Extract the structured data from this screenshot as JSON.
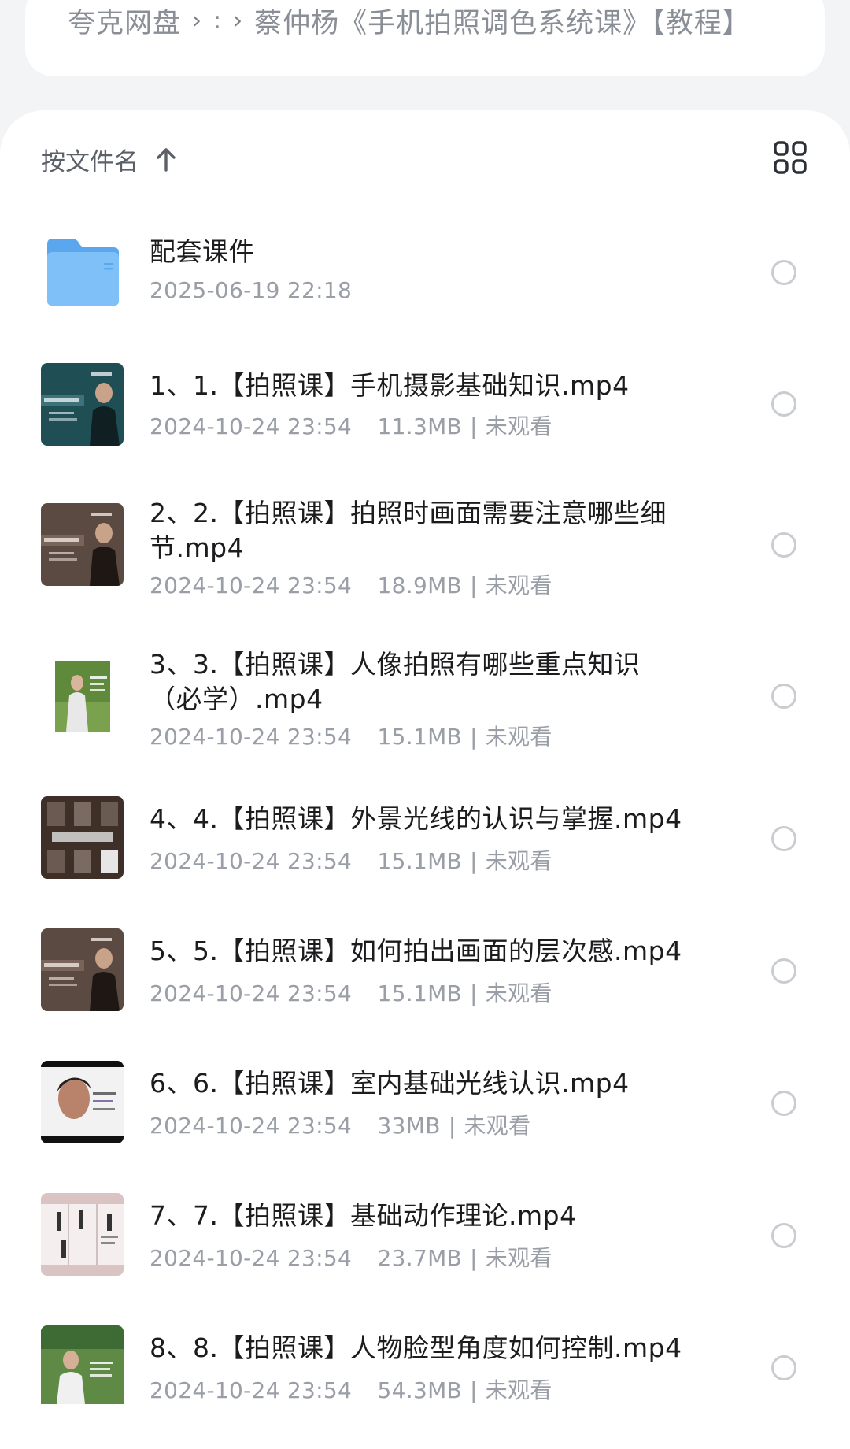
{
  "breadcrumb": {
    "root": "夸克网盘",
    "middle": ":",
    "current": "蔡仲杨《手机拍照调色系统课》【教程】"
  },
  "sort": {
    "label": "按文件名",
    "direction": "ascending"
  },
  "icons": {
    "sort": "arrow-up-icon",
    "view_toggle": "grid-view-icon",
    "folder": "folder-icon",
    "select": "radio-unchecked-icon"
  },
  "colors": {
    "folder": "#6db3f2",
    "background": "#f3f4f6",
    "meta_text": "#9a9ea6"
  },
  "files": [
    {
      "name": "配套课件",
      "type": "folder",
      "date": "2025-06-19 22:18",
      "size": "",
      "status": ""
    },
    {
      "name": "1、1.【拍照课】手机摄影基础知识.mp4",
      "type": "video",
      "date": "2024-10-24 23:54",
      "size": "11.3MB",
      "status": "未观看"
    },
    {
      "name": "2、2.【拍照课】拍照时画面需要注意哪些细节.mp4",
      "type": "video",
      "date": "2024-10-24 23:54",
      "size": "18.9MB",
      "status": "未观看"
    },
    {
      "name": "3、3.【拍照课】人像拍照有哪些重点知识（必学）.mp4",
      "type": "video",
      "date": "2024-10-24 23:54",
      "size": "15.1MB",
      "status": "未观看"
    },
    {
      "name": "4、4.【拍照课】外景光线的认识与掌握.mp4",
      "type": "video",
      "date": "2024-10-24 23:54",
      "size": "15.1MB",
      "status": "未观看"
    },
    {
      "name": "5、5.【拍照课】如何拍出画面的层次感.mp4",
      "type": "video",
      "date": "2024-10-24 23:54",
      "size": "15.1MB",
      "status": "未观看"
    },
    {
      "name": "6、6.【拍照课】室内基础光线认识.mp4",
      "type": "video",
      "date": "2024-10-24 23:54",
      "size": "33MB",
      "status": "未观看"
    },
    {
      "name": "7、7.【拍照课】基础动作理论.mp4",
      "type": "video",
      "date": "2024-10-24 23:54",
      "size": "23.7MB",
      "status": "未观看"
    },
    {
      "name": "8、8.【拍照课】人物脸型角度如何控制.mp4",
      "type": "video",
      "date": "2024-10-24 23:54",
      "size": "54.3MB",
      "status": "未观看"
    }
  ]
}
